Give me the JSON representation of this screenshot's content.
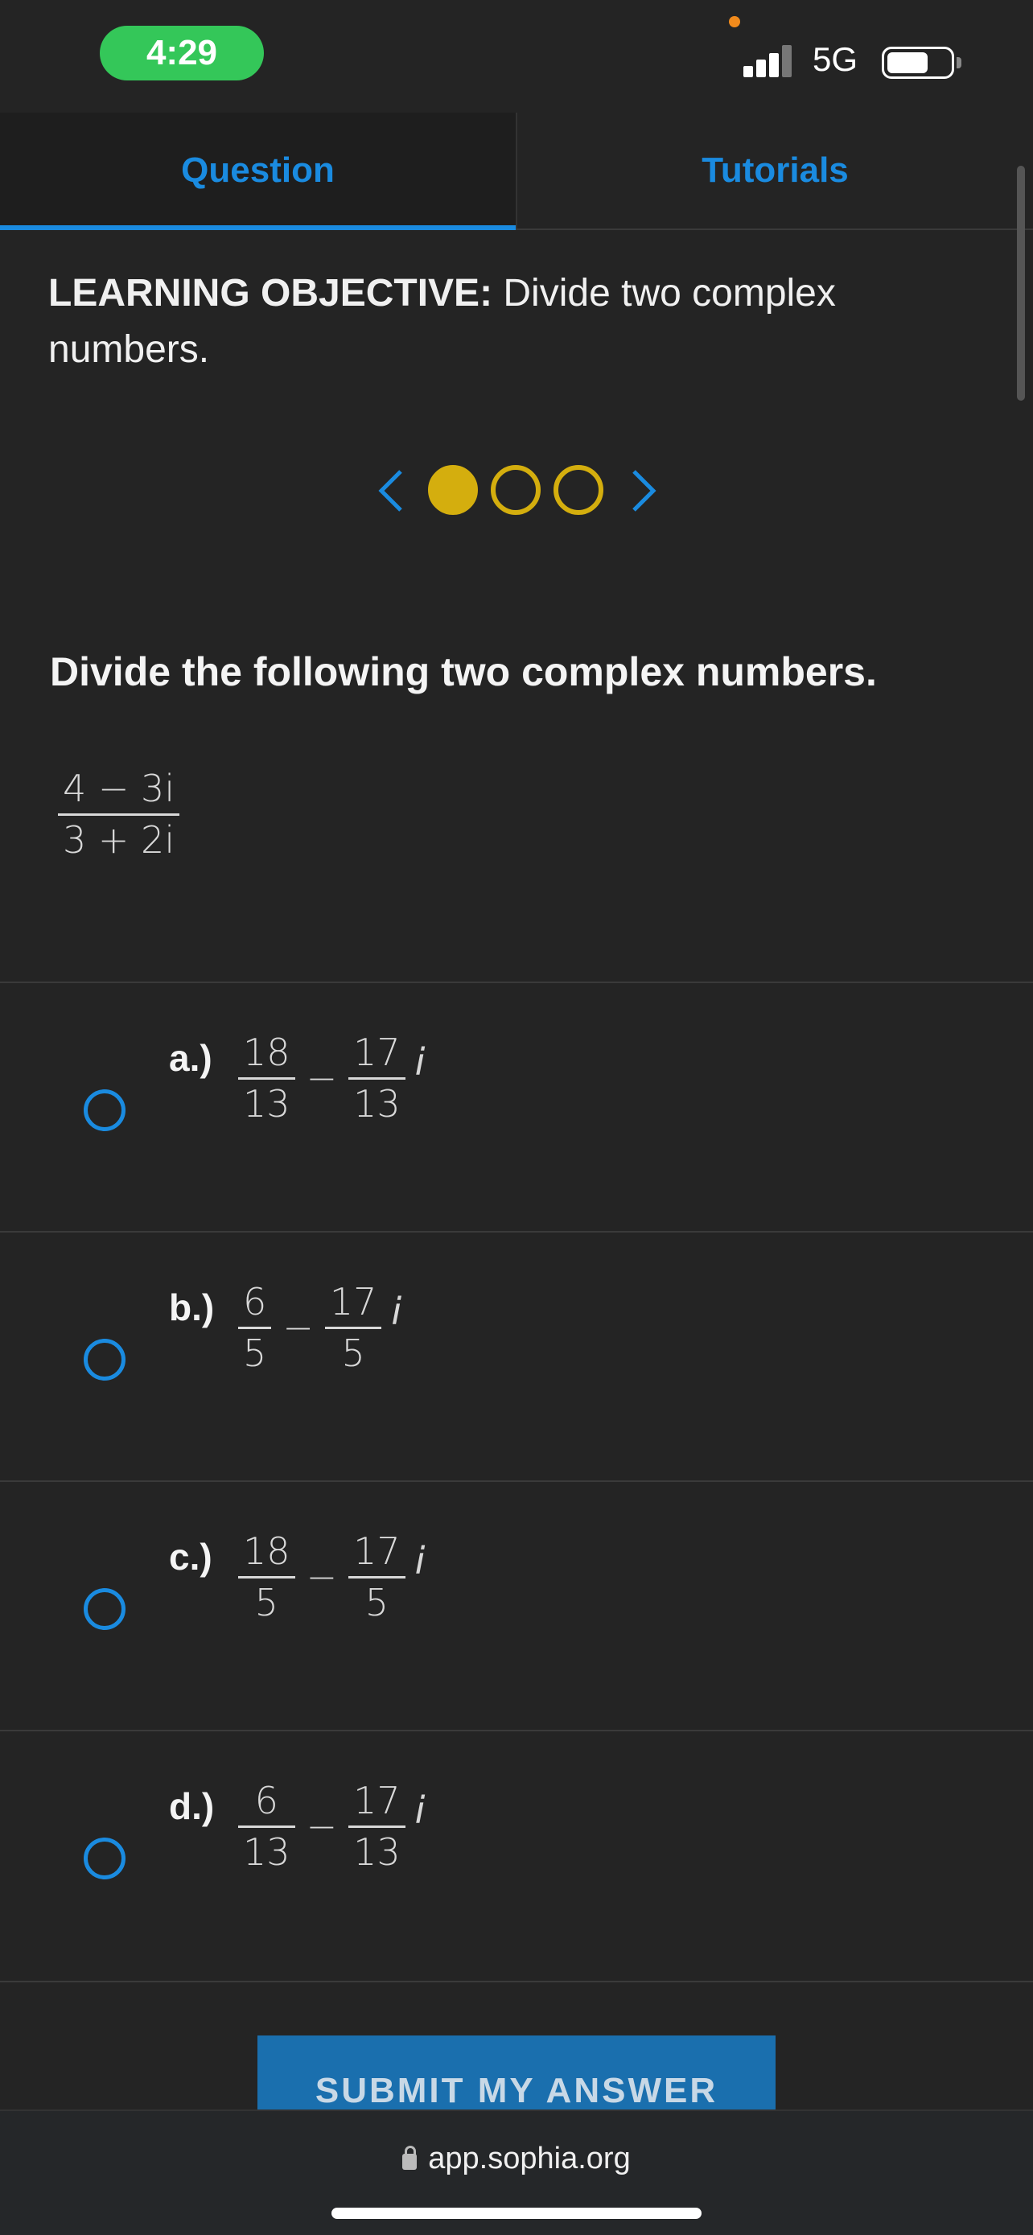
{
  "status_bar": {
    "time": "4:29",
    "network": "5G"
  },
  "tabs": [
    {
      "label": "Question",
      "active": true
    },
    {
      "label": "Tutorials",
      "active": false
    }
  ],
  "objective": {
    "label": "LEARNING OBJECTIVE:",
    "text": " Divide two complex numbers."
  },
  "pager": {
    "pages": 3,
    "current": 1
  },
  "question": {
    "prompt": "Divide the following two complex numbers.",
    "expression": {
      "num": "4 − 3i",
      "den": "3 + 2i"
    }
  },
  "options": [
    {
      "label": "a.)",
      "a_num": "18",
      "a_den": "13",
      "op": "−",
      "b_num": "17",
      "b_den": "13",
      "unit": "i"
    },
    {
      "label": "b.)",
      "a_num": "6",
      "a_den": "5",
      "op": "−",
      "b_num": "17",
      "b_den": "5",
      "unit": "i"
    },
    {
      "label": "c.)",
      "a_num": "18",
      "a_den": "5",
      "op": "−",
      "b_num": "17",
      "b_den": "5",
      "unit": "i"
    },
    {
      "label": "d.)",
      "a_num": "6",
      "a_den": "13",
      "op": "−",
      "b_num": "17",
      "b_den": "13",
      "unit": "i"
    }
  ],
  "submit_label": "SUBMIT MY ANSWER",
  "browser": {
    "url": "app.sophia.org"
  },
  "colors": {
    "accent": "#1a8be0",
    "pager": "#d4ae0e",
    "background": "#242424",
    "time_pill": "#34c759"
  }
}
